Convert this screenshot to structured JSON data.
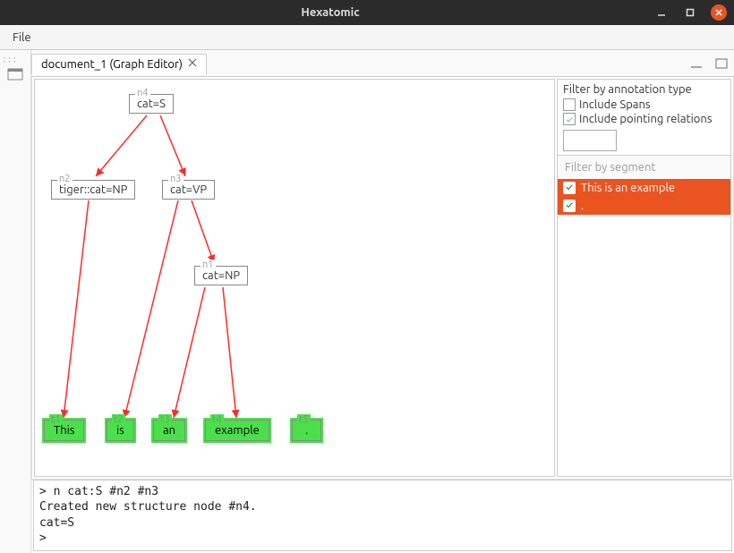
{
  "titlebar": {
    "title": "Hexatomic"
  },
  "menu": {
    "file": "File"
  },
  "tab": {
    "label": "document_1 (Graph Editor)"
  },
  "nodes": {
    "n4": {
      "id": "n4",
      "label": "cat=S"
    },
    "n2": {
      "id": "n2",
      "label": "tiger::cat=NP"
    },
    "n3": {
      "id": "n3",
      "label": "cat=VP"
    },
    "n1": {
      "id": "n1",
      "label": "cat=NP"
    },
    "t1": {
      "id": "t1",
      "label": "This"
    },
    "t2": {
      "id": "t2",
      "label": "is"
    },
    "t3": {
      "id": "t3",
      "label": "an"
    },
    "t4": {
      "id": "t4",
      "label": "example"
    },
    "t5": {
      "id": "t5",
      "label": "."
    }
  },
  "filter": {
    "title": "Filter by annotation type",
    "spans": "Include Spans",
    "pointing": "Include pointing relations"
  },
  "segments": {
    "title": "Filter by segment",
    "items": [
      "This is an example",
      "."
    ]
  },
  "console": "> n cat:S #n2 #n3\nCreated new structure node #n4.\ncat=S\n>"
}
